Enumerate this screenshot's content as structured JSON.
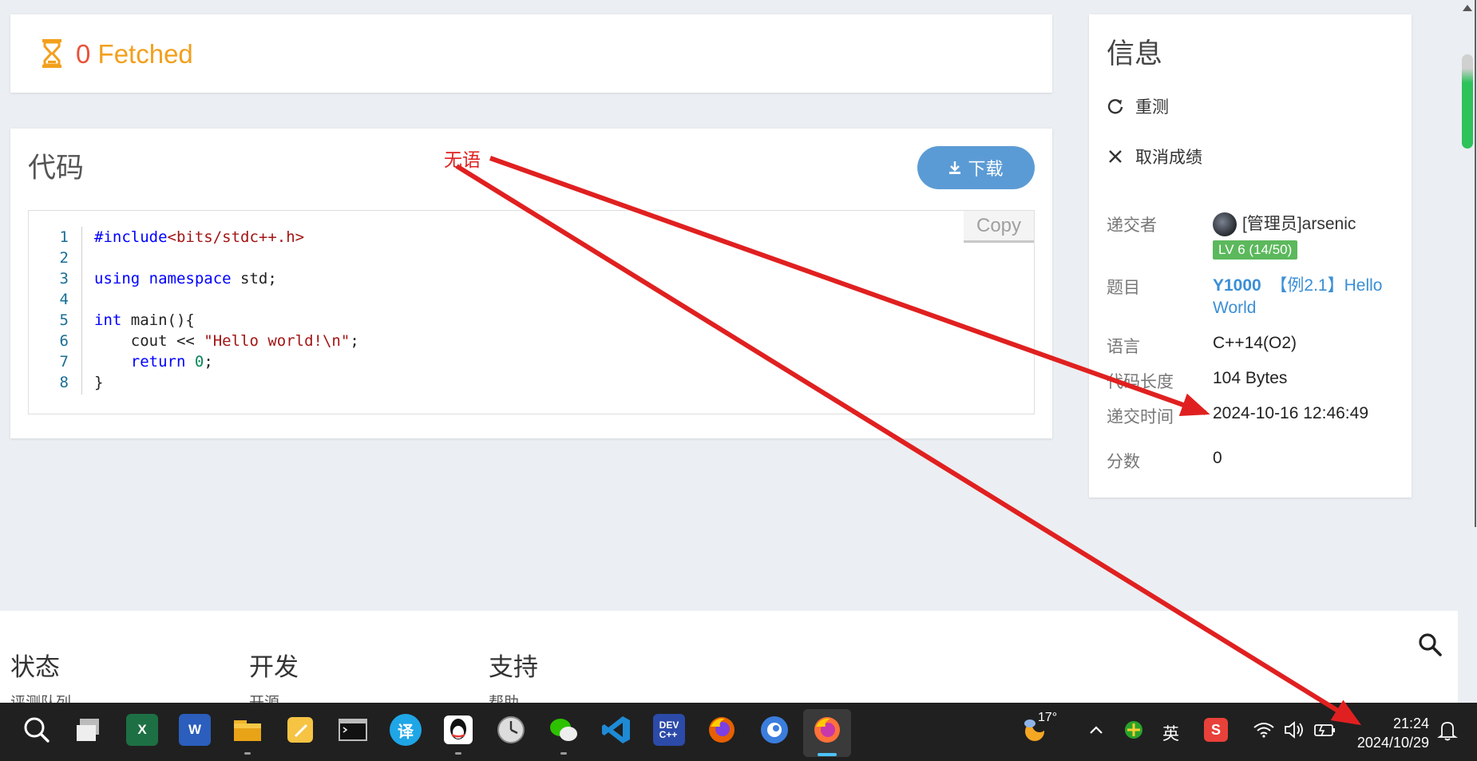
{
  "fetched": {
    "count": "0",
    "label": "Fetched"
  },
  "code": {
    "title": "代码",
    "download_label": "下载",
    "copy_label": "Copy",
    "lines": [
      {
        "n": "1",
        "text": "#include<bits/stdc++.h>"
      },
      {
        "n": "2",
        "text": ""
      },
      {
        "n": "3",
        "text": "using namespace std;"
      },
      {
        "n": "4",
        "text": ""
      },
      {
        "n": "5",
        "text": "int main(){"
      },
      {
        "n": "6",
        "text": "    cout << \"Hello world!\\n\";"
      },
      {
        "n": "7",
        "text": "    return 0;"
      },
      {
        "n": "8",
        "text": "}"
      }
    ]
  },
  "info": {
    "title": "信息",
    "rejudge": "重测",
    "cancel": "取消成绩",
    "submitter_label": "递交者",
    "submitter_name": "[管理员]arsenic",
    "level": "LV 6 (14/50)",
    "problem_label": "题目",
    "problem_id": "Y1000",
    "problem_name": "【例2.1】Hello World",
    "language_label": "语言",
    "language": "C++14(O2)",
    "length_label": "代码长度",
    "length": "104 Bytes",
    "time_label": "递交时间",
    "time": "2024-10-16 12:46:49",
    "score_label": "分数",
    "score": "0"
  },
  "footer": {
    "col1_title": "状态",
    "col1_sub": "评测队列",
    "col2_title": "开发",
    "col2_sub": "开源",
    "col3_title": "支持",
    "col3_sub": "帮助"
  },
  "annotation": {
    "text": "无语",
    "color": "#e02020"
  },
  "taskbar": {
    "weather": "17°",
    "ime": "英",
    "clock_time": "21:24",
    "clock_date": "2024/10/29",
    "apps": [
      "search",
      "task-view",
      "excel",
      "word",
      "file-explorer",
      "notes",
      "terminal",
      "translator",
      "qq",
      "clock",
      "wechat",
      "vscode",
      "dev-cpp",
      "firefox",
      "browser",
      "firefox-active"
    ]
  },
  "colors": {
    "accent": "#5b9bd5",
    "fetched": "#f2a01d",
    "badge": "#5cb85c",
    "link": "#3a8fd6"
  }
}
